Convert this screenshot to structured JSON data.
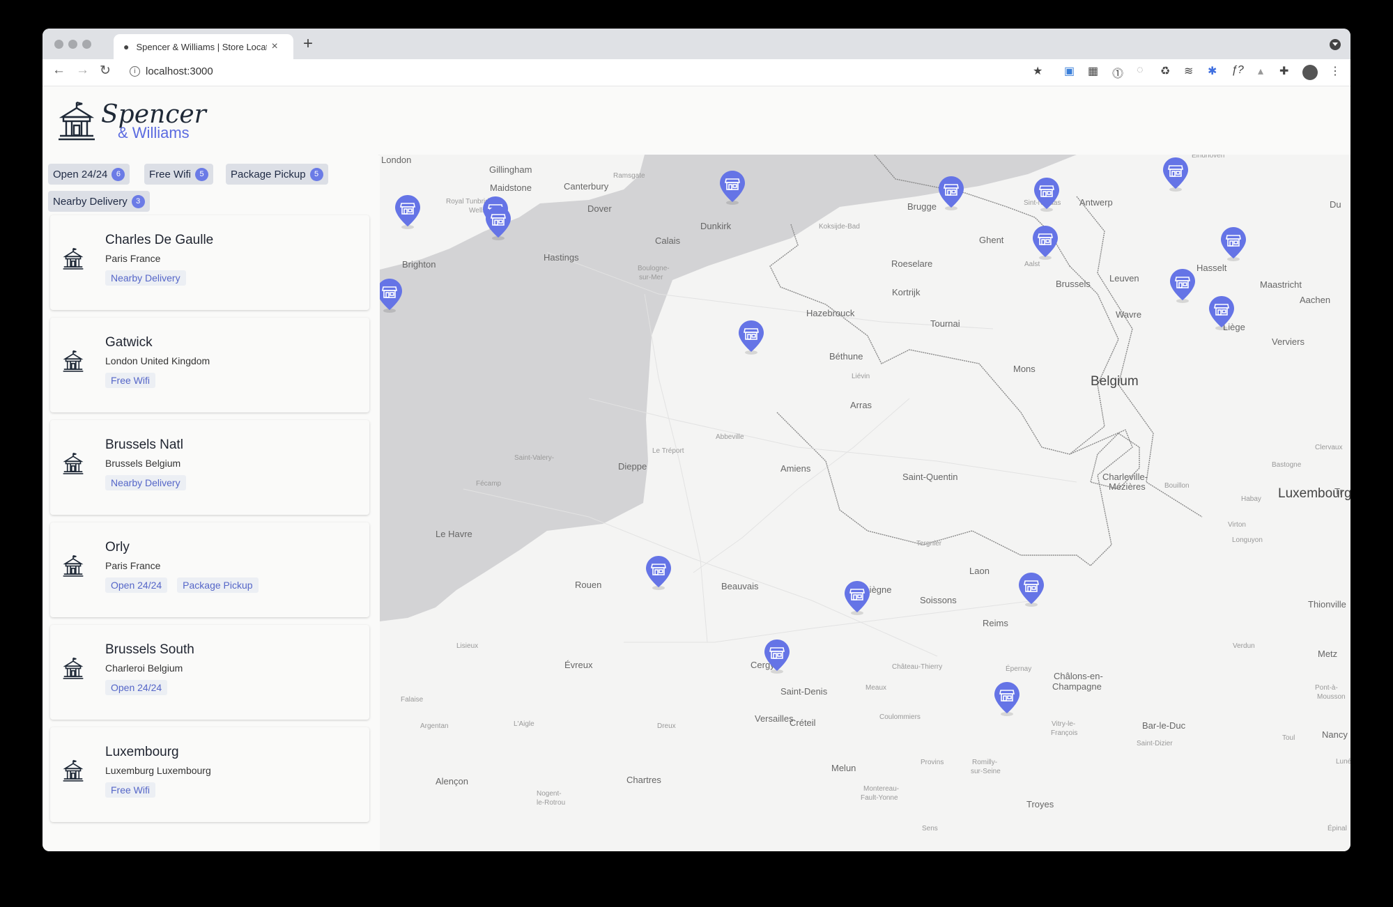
{
  "browser": {
    "tab_title": "Spencer & Williams | Store Locator",
    "url": "localhost:3000"
  },
  "brand": {
    "name": "Spencer",
    "sub": "& Williams"
  },
  "filters": [
    {
      "label": "Open 24/24",
      "count": "6"
    },
    {
      "label": "Free Wifi",
      "count": "5"
    },
    {
      "label": "Package Pickup",
      "count": "5"
    },
    {
      "label": "Nearby Delivery",
      "count": "3"
    }
  ],
  "stores": [
    {
      "name": "Charles De Gaulle",
      "location": "Paris France",
      "tags": [
        "Nearby Delivery"
      ]
    },
    {
      "name": "Gatwick",
      "location": "London United Kingdom",
      "tags": [
        "Free Wifi"
      ]
    },
    {
      "name": "Brussels Natl",
      "location": "Brussels Belgium",
      "tags": [
        "Nearby Delivery"
      ]
    },
    {
      "name": "Orly",
      "location": "Paris France",
      "tags": [
        "Open 24/24",
        "Package Pickup"
      ]
    },
    {
      "name": "Brussels South",
      "location": "Charleroi Belgium",
      "tags": [
        "Open 24/24"
      ]
    },
    {
      "name": "Luxembourg",
      "location": "Luxemburg Luxembourg",
      "tags": [
        "Free Wifi"
      ]
    }
  ],
  "map": {
    "land_color": "#f4f4f3",
    "water_color": "#d3d3d5",
    "marker_color": "#6574e6",
    "labels": {
      "london": "London",
      "gillingham": "Gillingham",
      "maidstone": "Maidstone",
      "canterbury": "Canterbury",
      "ramsgate": "Ramsgate",
      "royal_tunbridge": "Royal Tunbridge",
      "wells": "Wells",
      "dover": "Dover",
      "brighton": "Brighton",
      "hastings": "Hastings",
      "calais": "Calais",
      "dunkirk": "Dunkirk",
      "boulogne": "Boulogne-",
      "boulogne2": "sur-Mer",
      "koksijde": "Koksijde-Bad",
      "brugge": "Brugge",
      "sint_niklaas": "Sint-Niklaas",
      "antwerp": "Antwerp",
      "eindhoven": "Eindhoven",
      "ghent": "Ghent",
      "roeselare": "Roeselare",
      "aalst": "Aalst",
      "hasselt": "Hasselt",
      "kortrijk": "Kortrijk",
      "brussels": "Brussels",
      "leuven": "Leuven",
      "maastricht": "Maastricht",
      "aachen": "Aachen",
      "hazebrouck": "Hazebrouck",
      "tournai": "Tournai",
      "wavre": "Wavre",
      "liege": "Liège",
      "verviers": "Verviers",
      "bethune": "Béthune",
      "lievin": "Liévin",
      "mons": "Mons",
      "belgium": "Belgium",
      "arras": "Arras",
      "abbeville": "Abbeville",
      "le_treport": "Le Tréport",
      "dieppe": "Dieppe",
      "saint_valery": "Saint-Valery-",
      "amiens": "Amiens",
      "saint_quentin": "Saint-Quentin",
      "charleville": "Charleville-",
      "charleville2": "Mézières",
      "bouillon": "Bouillon",
      "bastogne": "Bastogne",
      "clervaux": "Clervaux",
      "habay": "Habay",
      "luxembourg": "Luxembourg",
      "virton": "Virton",
      "longuyon": "Longuyon",
      "fecamp": "Fécamp",
      "le_havre": "Le Havre",
      "rouen": "Rouen",
      "tergnier": "Tergnier",
      "laon": "Laon",
      "beauvais": "Beauvais",
      "compiegne": "Compiègne",
      "soissons": "Soissons",
      "thionville": "Thionville",
      "reims": "Reims",
      "lisieux": "Lisieux",
      "verdun": "Verdun",
      "evreux": "Évreux",
      "cergy": "Cergy",
      "saint_denis": "Saint-Denis",
      "chateau_thierry": "Château-Thierry",
      "epernay": "Épernay",
      "chalons": "Châlons-en-",
      "chalons2": "Champagne",
      "metz": "Metz",
      "meaux": "Meaux",
      "pont_a_mousson": "Pont-à-",
      "pont_a_mousson2": "Mousson",
      "falaise": "Falaise",
      "versailles": "Versailles",
      "creteil": "Créteil",
      "coulommiers": "Coulommiers",
      "vitry": "Vitry-le-",
      "vitry2": "François",
      "bar_le_duc": "Bar-le-Duc",
      "toul": "Toul",
      "nancy": "Nancy",
      "argentan": "Argentan",
      "laigle": "L'Aigle",
      "dreux": "Dreux",
      "saint_dizier": "Saint-Dizier",
      "luneville": "Lunéville",
      "provins": "Provins",
      "melun": "Melun",
      "romilly": "Romilly-",
      "romilly2": "sur-Seine",
      "alencon": "Alençon",
      "chartres": "Chartres",
      "nogent": "Nogent-",
      "nogent2": "le-Rotrou",
      "montereau": "Montereau-",
      "montereau2": "Fault-Yonne",
      "troyes": "Troyes",
      "sens": "Sens",
      "epinal": "Épinal",
      "tr": "Tr",
      "du": "Du"
    }
  }
}
